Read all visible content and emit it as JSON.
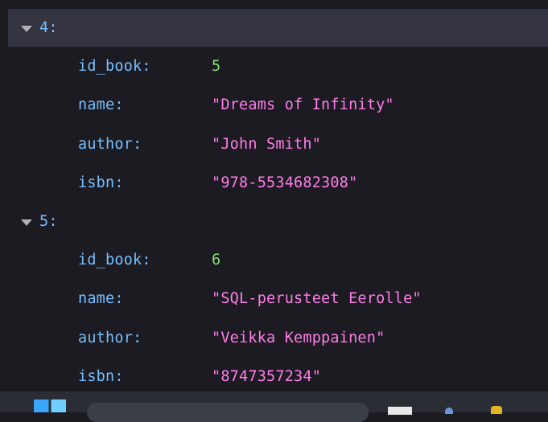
{
  "records": [
    {
      "index_label": "4:",
      "fields": [
        {
          "key": "id_book:",
          "value": "5",
          "type": "number"
        },
        {
          "key": "name:",
          "value": "\"Dreams of Infinity\"",
          "type": "string"
        },
        {
          "key": "author:",
          "value": "\"John Smith\"",
          "type": "string"
        },
        {
          "key": "isbn:",
          "value": "\"978-5534682308\"",
          "type": "string"
        }
      ]
    },
    {
      "index_label": "5:",
      "fields": [
        {
          "key": "id_book:",
          "value": "6",
          "type": "number"
        },
        {
          "key": "name:",
          "value": "\"SQL-perusteet Eerolle\"",
          "type": "string"
        },
        {
          "key": "author:",
          "value": "\"Veikka Kemppainen\"",
          "type": "string"
        },
        {
          "key": "isbn:",
          "value": "\"8747357234\"",
          "type": "string"
        }
      ]
    }
  ],
  "colors": {
    "key": "#75bfff",
    "number": "#86de74",
    "string": "#ff7de9",
    "background": "#1c1b22",
    "highlight_row": "#343441"
  },
  "icons": {
    "toggle": "triangle-down-icon"
  }
}
